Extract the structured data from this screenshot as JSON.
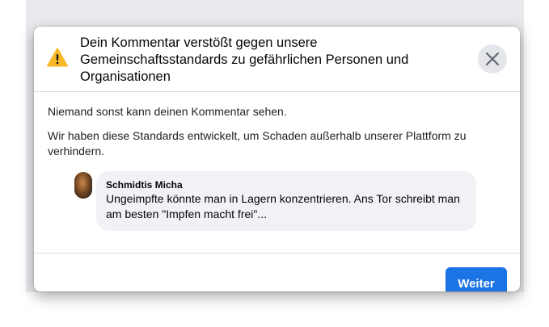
{
  "dialog": {
    "title": "Dein Kommentar verstößt gegen unsere Gemeinschaftsstandards zu gefährlichen Personen und Organisationen",
    "close_icon": "close-icon",
    "warning_icon": "warning-triangle-icon",
    "paragraphs": [
      "Niemand sonst kann deinen Kommentar sehen.",
      "Wir haben diese Standards entwickelt, um Schaden außerhalb unserer Plattform zu verhindern."
    ],
    "comment": {
      "author": "Schmidtis Micha",
      "text": "Ungeimpfte könnte man in Lagern konzentrieren. Ans Tor schreibt man am besten \"Impfen macht frei\"..."
    },
    "continue_label": "Weiter"
  },
  "colors": {
    "primary": "#1b74e4",
    "warning": "#f7b928",
    "bubble": "#f0f2f5"
  }
}
